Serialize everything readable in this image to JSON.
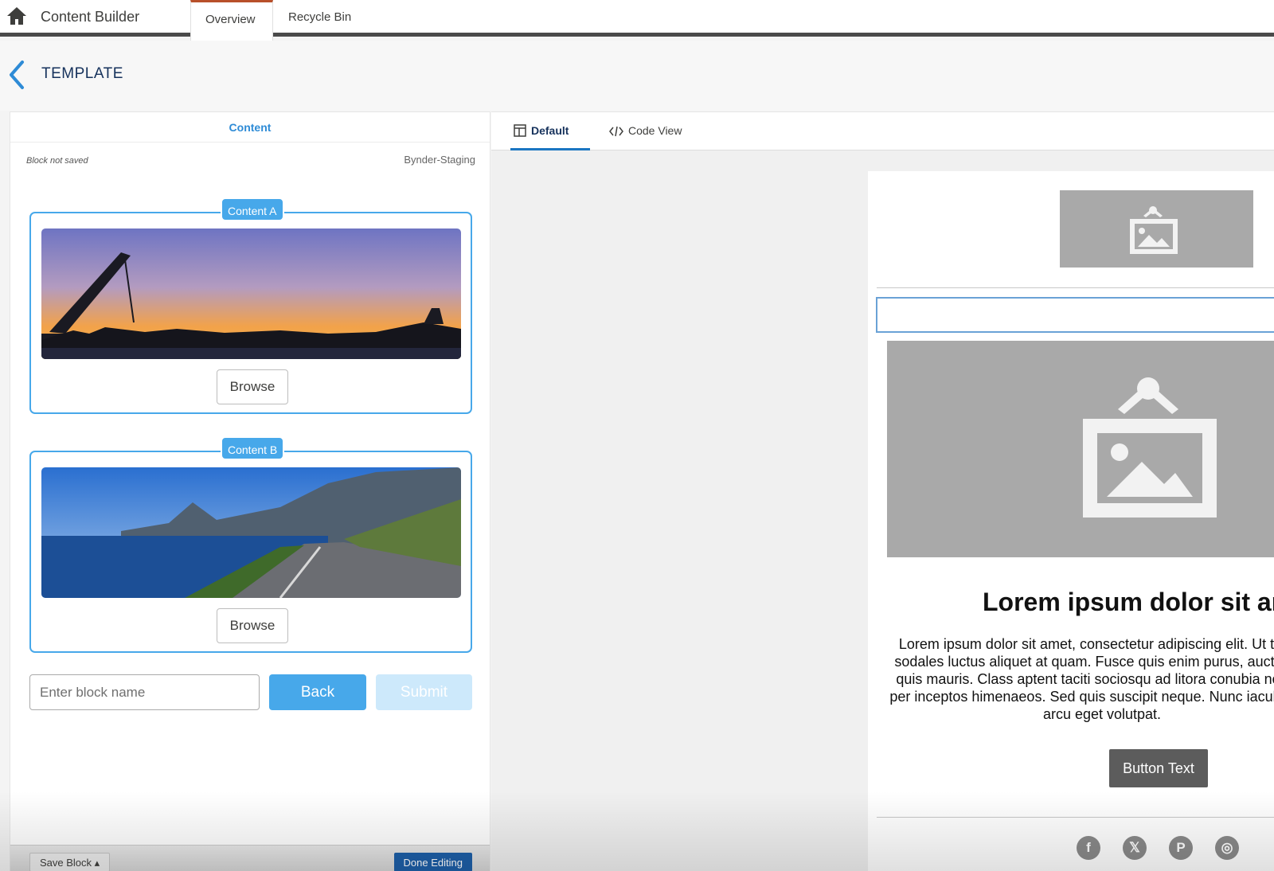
{
  "topbar": {
    "app_title": "Content Builder",
    "tabs": [
      {
        "label": "Overview",
        "active": true
      },
      {
        "label": "Recycle Bin",
        "active": false
      }
    ],
    "home_icon": "home-icon"
  },
  "header": {
    "title": "TEMPLATE",
    "back_icon": "chevron-left-icon"
  },
  "left_panel": {
    "tab_label": "Content",
    "status": "Block not saved",
    "source": "Bynder-Staging",
    "cards": [
      {
        "badge": "Content A",
        "browse_label": "Browse",
        "image": "harbor-sunset-photo"
      },
      {
        "badge": "Content B",
        "browse_label": "Browse",
        "image": "coastal-road-photo"
      }
    ],
    "block_name_placeholder": "Enter block name",
    "back_label": "Back",
    "submit_label": "Submit",
    "save_block_label": "Save Block ▴",
    "done_label": "Done Editing"
  },
  "view_tabs": {
    "default_label": "Default",
    "code_label": "Code View"
  },
  "email": {
    "headline": "Lorem ipsum dolor sit amet",
    "body": "Lorem ipsum dolor sit amet, consectetur adipiscing elit. Ut turpis sodales luctus aliquet at quam. Fusce quis enim purus, auctor vel quis mauris. Class aptent taciti sociosqu ad litora conubia nostra, per inceptos himenaeos. Sed quis suscipit neque. Nunc iaculis non arcu eget volutpat.",
    "button_label": "Button Text",
    "social": [
      {
        "icon": "facebook-icon",
        "glyph": "f"
      },
      {
        "icon": "x-icon",
        "glyph": "𝕏"
      },
      {
        "icon": "pinterest-icon",
        "glyph": "P"
      },
      {
        "icon": "instagram-icon",
        "glyph": "◎"
      }
    ]
  },
  "colors": {
    "accent": "#47a8ea",
    "primary_dark": "#1d5fa8",
    "placeholder_gray": "#a9a9a9",
    "active_tab_top": "#b8502a"
  }
}
